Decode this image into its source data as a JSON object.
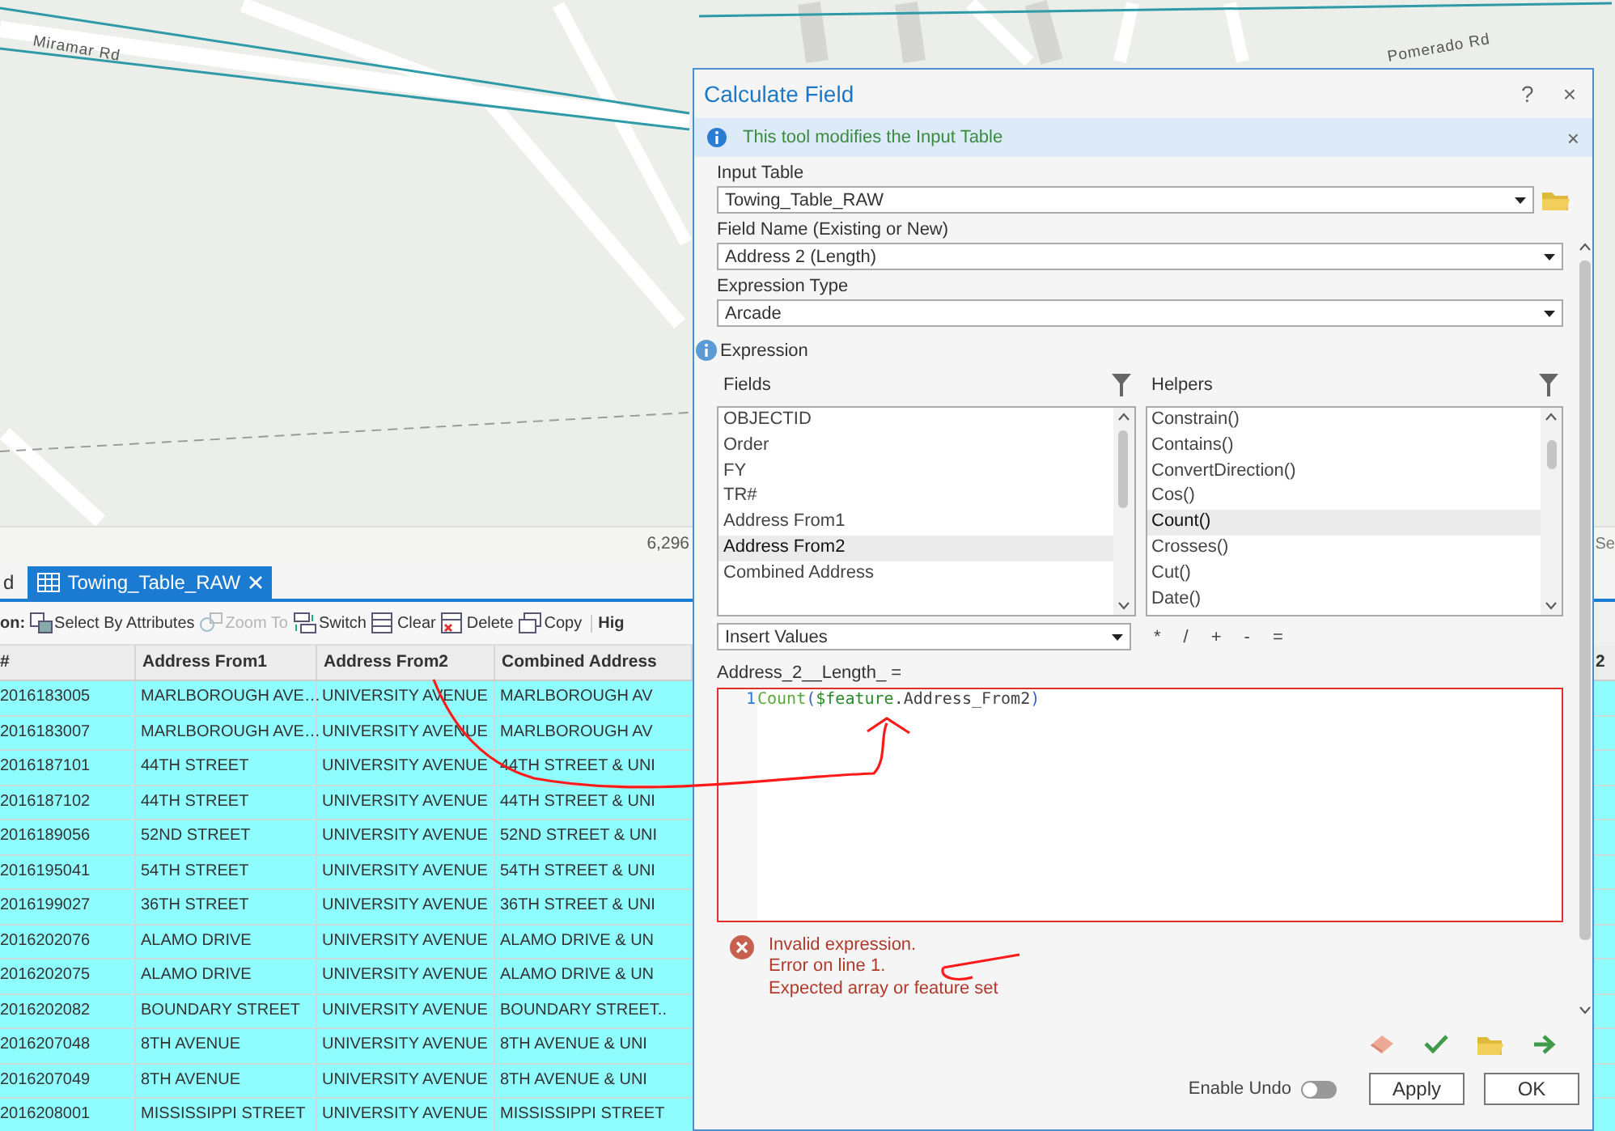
{
  "map": {
    "labels": [
      {
        "text": "Miramar Rd",
        "kind": "west"
      },
      {
        "text": "Pomerado Rd",
        "kind": "east"
      }
    ],
    "scale": "6,296",
    "search_hint": "Se"
  },
  "tabs": [
    {
      "label": "d",
      "selected": false
    },
    {
      "label": "Towing_Table_RAW",
      "selected": true
    }
  ],
  "toolbar": {
    "label": "on:",
    "buttons": [
      {
        "label": "Select By Attributes",
        "kind": "select",
        "disabled": false
      },
      {
        "label": "Zoom To",
        "kind": "zoom",
        "disabled": true
      },
      {
        "label": "Switch",
        "kind": "switch",
        "disabled": false
      },
      {
        "label": "Clear",
        "kind": "clear",
        "disabled": false
      },
      {
        "label": "Delete",
        "kind": "delete",
        "disabled": false
      },
      {
        "label": "Copy",
        "kind": "copy",
        "disabled": false
      }
    ],
    "group_label": "Hig"
  },
  "table": {
    "columns": [
      "#",
      "Address From1",
      "Address From2",
      "Combined Address",
      "2"
    ],
    "rows": [
      {
        "cells": [
          "2016183005",
          "MARLBOROUGH AVE…",
          "UNIVERSITY AVENUE",
          "MARLBOROUGH AV"
        ],
        "selected": true
      },
      {
        "cells": [
          "2016183007",
          "MARLBOROUGH AVE…",
          "UNIVERSITY AVENUE",
          "MARLBOROUGH AV"
        ],
        "selected": true
      },
      {
        "cells": [
          "2016187101",
          "44TH STREET",
          "UNIVERSITY AVENUE",
          "44TH STREET & UNI"
        ],
        "selected": true
      },
      {
        "cells": [
          "2016187102",
          "44TH STREET",
          "UNIVERSITY AVENUE",
          "44TH STREET & UNI"
        ],
        "selected": true
      },
      {
        "cells": [
          "2016189056",
          "52ND STREET",
          "UNIVERSITY AVENUE",
          "52ND STREET & UNI"
        ],
        "selected": true
      },
      {
        "cells": [
          "2016195041",
          "54TH STREET",
          "UNIVERSITY AVENUE",
          "54TH STREET & UNI"
        ],
        "selected": true
      },
      {
        "cells": [
          "2016199027",
          "36TH STREET",
          "UNIVERSITY AVENUE",
          "36TH STREET & UNI"
        ],
        "selected": true
      },
      {
        "cells": [
          "2016202076",
          "ALAMO DRIVE",
          "UNIVERSITY AVENUE",
          "ALAMO DRIVE & UN"
        ],
        "selected": true
      },
      {
        "cells": [
          "2016202075",
          "ALAMO DRIVE",
          "UNIVERSITY AVENUE",
          "ALAMO DRIVE & UN"
        ],
        "selected": true
      },
      {
        "cells": [
          "2016202082",
          "BOUNDARY STREET",
          "UNIVERSITY AVENUE",
          "BOUNDARY STREET.."
        ],
        "selected": true
      },
      {
        "cells": [
          "2016207048",
          "8TH AVENUE",
          "UNIVERSITY AVENUE",
          "8TH AVENUE & UNI"
        ],
        "selected": true
      },
      {
        "cells": [
          "2016207049",
          "8TH AVENUE",
          "UNIVERSITY AVENUE",
          "8TH AVENUE & UNI"
        ],
        "selected": true
      },
      {
        "cells": [
          "2016208001",
          "MISSISSIPPI STREET",
          "UNIVERSITY AVENUE",
          "MISSISSIPPI STREET"
        ],
        "selected": true
      }
    ]
  },
  "dialog": {
    "title": "Calculate Field",
    "help": "?",
    "close": "×",
    "info": "This tool modifies the Input Table",
    "params": [
      {
        "label": "Input Table",
        "value": "Towing_Table_RAW",
        "browse": true
      },
      {
        "label": "Field Name (Existing or New)",
        "value": "Address 2 (Length)",
        "browse": false
      },
      {
        "label": "Expression Type",
        "value": "Arcade",
        "browse": false
      }
    ],
    "expression_label": "Expression",
    "fields": {
      "label": "Fields",
      "items": [
        {
          "label": "OBJECTID",
          "selected": false
        },
        {
          "label": "Order",
          "selected": false
        },
        {
          "label": "FY",
          "selected": false
        },
        {
          "label": "TR#",
          "selected": false
        },
        {
          "label": "Address From1",
          "selected": false
        },
        {
          "label": "Address From2",
          "selected": true
        },
        {
          "label": "Combined Address",
          "selected": false
        }
      ]
    },
    "helpers": {
      "label": "Helpers",
      "items": [
        {
          "label": "Constrain()",
          "selected": false
        },
        {
          "label": "Contains()",
          "selected": false
        },
        {
          "label": "ConvertDirection()",
          "selected": false
        },
        {
          "label": "Cos()",
          "selected": false
        },
        {
          "label": "Count()",
          "selected": true
        },
        {
          "label": "Crosses()",
          "selected": false
        },
        {
          "label": "Cut()",
          "selected": false
        },
        {
          "label": "Date()",
          "selected": false
        }
      ]
    },
    "insert": "Insert Values",
    "operators": [
      "*",
      "/",
      "+",
      "-",
      "="
    ],
    "target": "Address_2__Length_ =",
    "code": {
      "line": "1",
      "tokens": [
        {
          "text": "Count",
          "kind": "function"
        },
        {
          "text": "(",
          "kind": "paren"
        },
        {
          "text": "$feature",
          "kind": "variable"
        },
        {
          "text": ".Address_From2",
          "kind": "plain"
        },
        {
          "text": ")",
          "kind": "paren"
        }
      ],
      "invalid": true
    },
    "errors": [
      "Invalid expression.",
      "Error on line 1.",
      "Expected array or feature set"
    ],
    "enable_undo": {
      "label": "Enable Undo",
      "on": false
    },
    "buttons": [
      "Apply",
      "OK"
    ]
  }
}
